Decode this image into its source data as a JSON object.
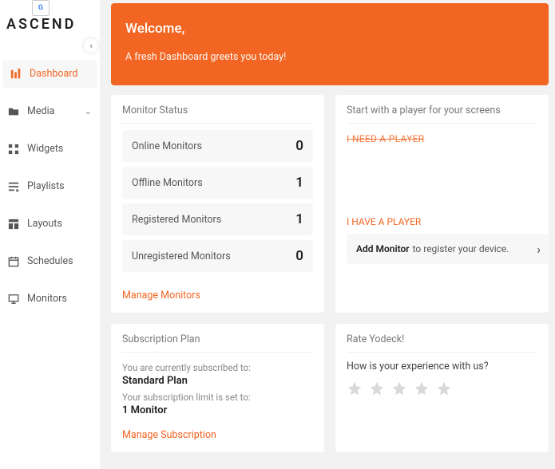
{
  "brand": {
    "name": "ASCEND"
  },
  "sidebar": {
    "items": [
      {
        "label": "Dashboard",
        "icon": "bars-icon",
        "active": true
      },
      {
        "label": "Media",
        "icon": "folder-icon",
        "expandable": true
      },
      {
        "label": "Widgets",
        "icon": "grid-icon"
      },
      {
        "label": "Playlists",
        "icon": "list-icon"
      },
      {
        "label": "Layouts",
        "icon": "layout-icon"
      },
      {
        "label": "Schedules",
        "icon": "calendar-icon"
      },
      {
        "label": "Monitors",
        "icon": "monitor-icon"
      }
    ]
  },
  "welcome": {
    "title": "Welcome,",
    "subtitle": "A fresh Dashboard greets you today!"
  },
  "monitor_status": {
    "title": "Monitor Status",
    "rows": [
      {
        "label": "Online Monitors",
        "value": "0"
      },
      {
        "label": "Offline Monitors",
        "value": "1"
      },
      {
        "label": "Registered Monitors",
        "value": "1"
      },
      {
        "label": "Unregistered Monitors",
        "value": "0"
      }
    ],
    "link": "Manage Monitors"
  },
  "player": {
    "title": "Start with a player for your screens",
    "need_label": "I NEED A PLAYER",
    "have_label": "I HAVE A PLAYER",
    "add_bold": "Add Monitor",
    "add_rest": "to register your device."
  },
  "subscription": {
    "title": "Subscription Plan",
    "sub1": "You are currently subscribed to:",
    "plan": "Standard Plan",
    "sub2": "Your subscription limit is set to:",
    "limit": "1 Monitor",
    "link": "Manage Subscription"
  },
  "rate": {
    "title": "Rate Yodeck!",
    "question": "How is your experience with us?"
  }
}
